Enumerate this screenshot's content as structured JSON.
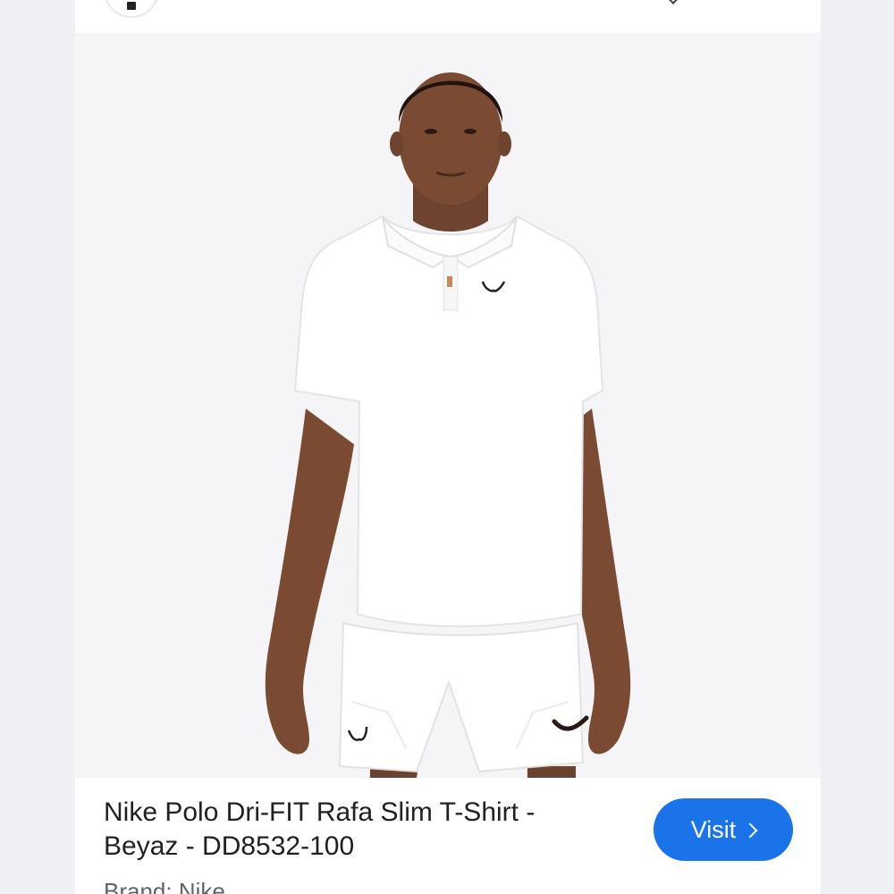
{
  "product": {
    "title": "Nike Polo Dri-FIT Rafa Slim T-Shirt - Beyaz - DD8532-100",
    "brand_line": "Brand: Nike"
  },
  "actions": {
    "visit_label": "Visit"
  },
  "icons": {
    "site_favicon": "store-favicon-icon",
    "visit_chevron": "chevron-right-icon",
    "top_chevron": "chevron-down-icon"
  },
  "colors": {
    "accent": "#1a73e8",
    "image_background": "#f5f5f7",
    "page_background": "#eef0f4"
  }
}
